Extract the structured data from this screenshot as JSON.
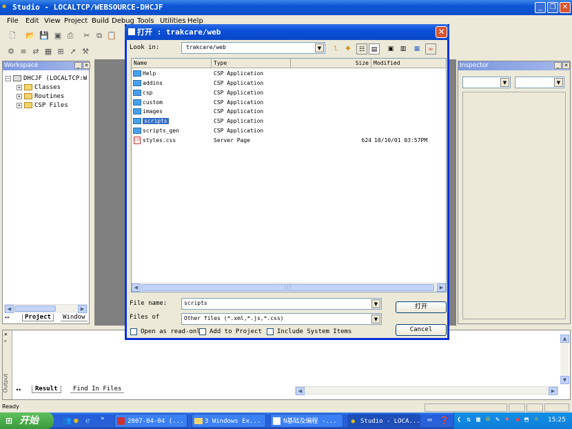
{
  "window": {
    "title": "Studio - LOCALTCP/WEBSOURCE-DHCJF",
    "minimize_icon": "minimize-icon",
    "restore_icon": "restore-icon",
    "close_icon": "close-icon"
  },
  "menu": {
    "items": [
      "File",
      "Edit",
      "View",
      "Project",
      "Build",
      "Debug",
      "Tools",
      "Utilities",
      "Help"
    ]
  },
  "workspace": {
    "title": "Workspace",
    "root": "DHCJF (LOCALTCP:W",
    "children": [
      "Classes",
      "Routines",
      "CSP Files"
    ],
    "tabs": [
      "Project",
      "Window"
    ]
  },
  "inspector": {
    "title": "Inspector"
  },
  "output": {
    "side_label": "Output",
    "tabs": [
      "Result",
      "Find In Files"
    ]
  },
  "status": {
    "text": "Ready"
  },
  "taskbar": {
    "start_label": "开始",
    "tasks": [
      "2007-04-04 (...",
      "3 Windows Ex...",
      "N基础及编程 -...",
      "Studio - LOCA..."
    ],
    "clock": "15:25"
  },
  "dialog": {
    "title": "打开 : trakcare/web",
    "look_in_label": "Look in:",
    "look_in_value": "trakcare/web",
    "columns": [
      "Name",
      "Type",
      "Size",
      "Modified"
    ],
    "files": [
      {
        "name": "Help",
        "type": "CSP Application",
        "size": "",
        "modified": "",
        "kind": "folder"
      },
      {
        "name": "addins",
        "type": "CSP Application",
        "size": "",
        "modified": "",
        "kind": "folder"
      },
      {
        "name": "csp",
        "type": "CSP Application",
        "size": "",
        "modified": "",
        "kind": "folder"
      },
      {
        "name": "custom",
        "type": "CSP Application",
        "size": "",
        "modified": "",
        "kind": "folder"
      },
      {
        "name": "images",
        "type": "CSP Application",
        "size": "",
        "modified": "",
        "kind": "folder"
      },
      {
        "name": "scripts",
        "type": "CSP Application",
        "size": "",
        "modified": "",
        "kind": "folder"
      },
      {
        "name": "scripts_gen",
        "type": "CSP Application",
        "size": "",
        "modified": "",
        "kind": "folder"
      },
      {
        "name": "styles.css",
        "type": "Server Page",
        "size": "624",
        "modified": "10/10/01 03:57PM",
        "kind": "file"
      }
    ],
    "selected_index": 5,
    "file_name_label": "File name:",
    "file_name_value": "scripts",
    "files_of_label": "Files of",
    "files_of_value": "Other files (*.xml,*.js,*.css)",
    "open_button": "打开",
    "cancel_button": "Cancel",
    "open_readonly_label": "Open as read-only",
    "add_to_project_label": "Add to Project",
    "include_system_label": "Include System Items"
  }
}
